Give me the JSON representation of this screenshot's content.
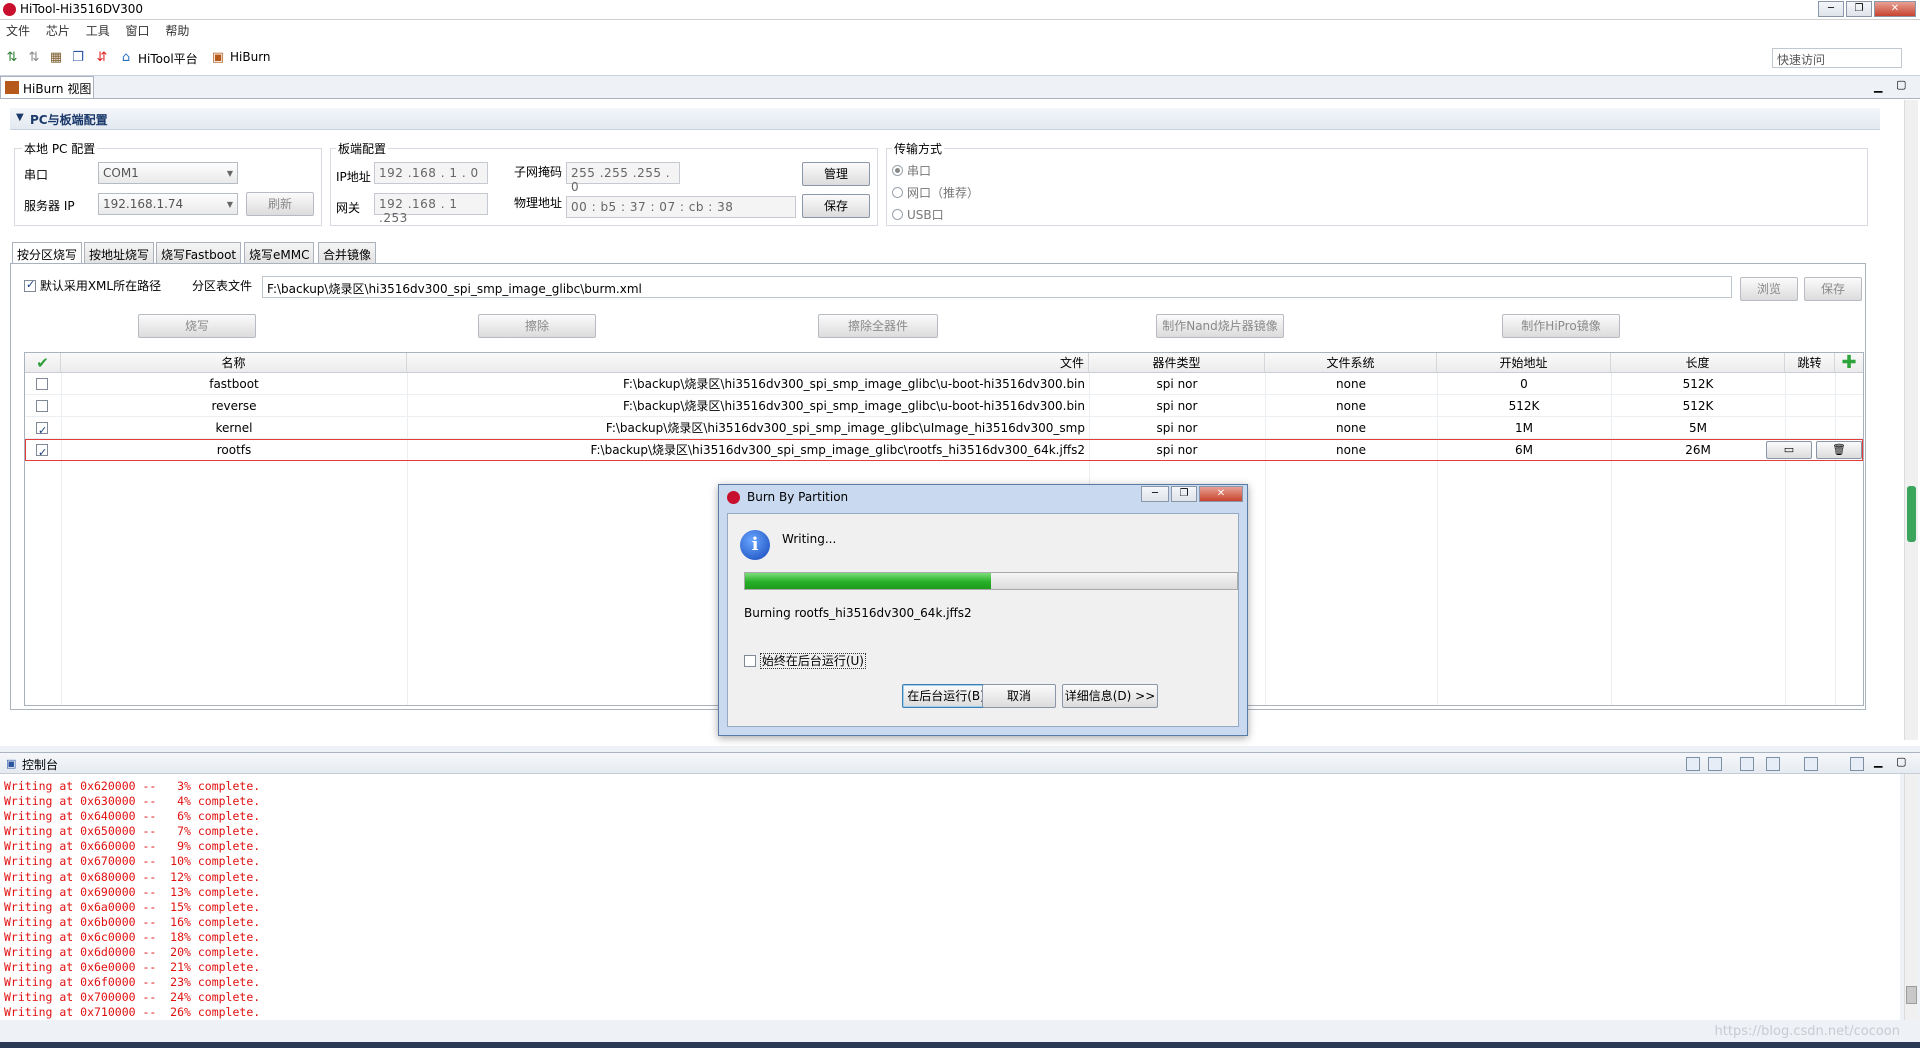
{
  "window": {
    "title": "HiTool-Hi3516DV300",
    "controls": [
      "─",
      "❐",
      "✕"
    ]
  },
  "menu": [
    "文件",
    "芯片",
    "工具",
    "窗口",
    "帮助"
  ],
  "toolbar": {
    "hitool_label": "HiTool平台",
    "hiburn_label": "HiBurn",
    "quick_access": "快速访问"
  },
  "view_tab": {
    "label": "HiBurn 视图"
  },
  "section": {
    "title": "PC与板端配置"
  },
  "local_pc": {
    "title": "本地 PC 配置",
    "serial_label": "串口",
    "serial_value": "COM1",
    "server_ip_label": "服务器 IP",
    "server_ip_value": "192.168.1.74",
    "refresh_label": "刷新"
  },
  "board": {
    "title": "板端配置",
    "ip_label": "IP地址",
    "ip_value": "192 .168 . 1 . 0",
    "subnet_label": "子网掩码",
    "subnet_value": "255 .255 .255 . 0",
    "gateway_label": "网关",
    "gateway_value": "192 .168 . 1 .253",
    "mac_label": "物理地址",
    "mac_value": "00 : b5 : 37 : 07 : cb : 38",
    "manage_label": "管理",
    "save_label": "保存"
  },
  "transfer": {
    "title": "传输方式",
    "options": [
      "串口",
      "网口（推荐）",
      "USB口"
    ],
    "selected": "串口"
  },
  "tabs": [
    "按分区烧写",
    "按地址烧写",
    "烧写Fastboot",
    "烧写eMMC",
    "合并镜像"
  ],
  "partition": {
    "use_xml_path_label": "默认采用XML所在路径",
    "use_xml_path_checked": true,
    "table_file_label": "分区表文件",
    "table_file_value": "F:\\backup\\烧录区\\hi3516dv300_spi_smp_image_glibc\\burm.xml",
    "browse_label": "浏览",
    "save_label": "保存",
    "actions": [
      "烧写",
      "擦除",
      "擦除全器件",
      "制作Nand烧片器镜像",
      "制作HiPro镜像"
    ]
  },
  "table": {
    "columns": [
      "名称",
      "文件",
      "器件类型",
      "文件系统",
      "开始地址",
      "长度",
      "跳转"
    ],
    "rows": [
      {
        "checked": false,
        "name": "fastboot",
        "file": "F:\\backup\\烧录区\\hi3516dv300_spi_smp_image_glibc\\u-boot-hi3516dv300.bin",
        "device": "spi nor",
        "fs": "none",
        "start": "0",
        "length": "512K"
      },
      {
        "checked": false,
        "name": "reverse",
        "file": "F:\\backup\\烧录区\\hi3516dv300_spi_smp_image_glibc\\u-boot-hi3516dv300.bin",
        "device": "spi nor",
        "fs": "none",
        "start": "512K",
        "length": "512K"
      },
      {
        "checked": true,
        "name": "kernel",
        "file": "F:\\backup\\烧录区\\hi3516dv300_spi_smp_image_glibc\\uImage_hi3516dv300_smp",
        "device": "spi nor",
        "fs": "none",
        "start": "1M",
        "length": "5M"
      },
      {
        "checked": true,
        "name": "rootfs",
        "file": "F:\\backup\\烧录区\\hi3516dv300_spi_smp_image_glibc\\rootfs_hi3516dv300_64k.jffs2",
        "device": "spi nor",
        "fs": "none",
        "start": "6M",
        "length": "26M"
      }
    ]
  },
  "dialog": {
    "title": "Burn By Partition",
    "message": "Writing...",
    "progress": 0.5,
    "detail": "Burning rootfs_hi3516dv300_64k.jffs2",
    "always_background_label": "始终在后台运行(U)",
    "background_button": "在后台运行(B)",
    "cancel_button": "取消",
    "details_button": "详细信息(D) >>"
  },
  "console": {
    "title": "控制台",
    "lines": [
      "Writing at 0x620000 --   3% complete.",
      "Writing at 0x630000 --   4% complete.",
      "Writing at 0x640000 --   6% complete.",
      "Writing at 0x650000 --   7% complete.",
      "Writing at 0x660000 --   9% complete.",
      "Writing at 0x670000 --  10% complete.",
      "Writing at 0x680000 --  12% complete.",
      "Writing at 0x690000 --  13% complete.",
      "Writing at 0x6a0000 --  15% complete.",
      "Writing at 0x6b0000 --  16% complete.",
      "Writing at 0x6c0000 --  18% complete.",
      "Writing at 0x6d0000 --  20% complete.",
      "Writing at 0x6e0000 --  21% complete.",
      "Writing at 0x6f0000 --  23% complete.",
      "Writing at 0x700000 --  24% complete.",
      "Writing at 0x710000 --  26% complete."
    ]
  },
  "watermark": "https://blog.csdn.net/cocoon",
  "colors": {
    "accent": "#1b3a6b",
    "progress_green": "#27b027",
    "console_text": "#e01010",
    "selected_row_border": "#e23c3c"
  }
}
